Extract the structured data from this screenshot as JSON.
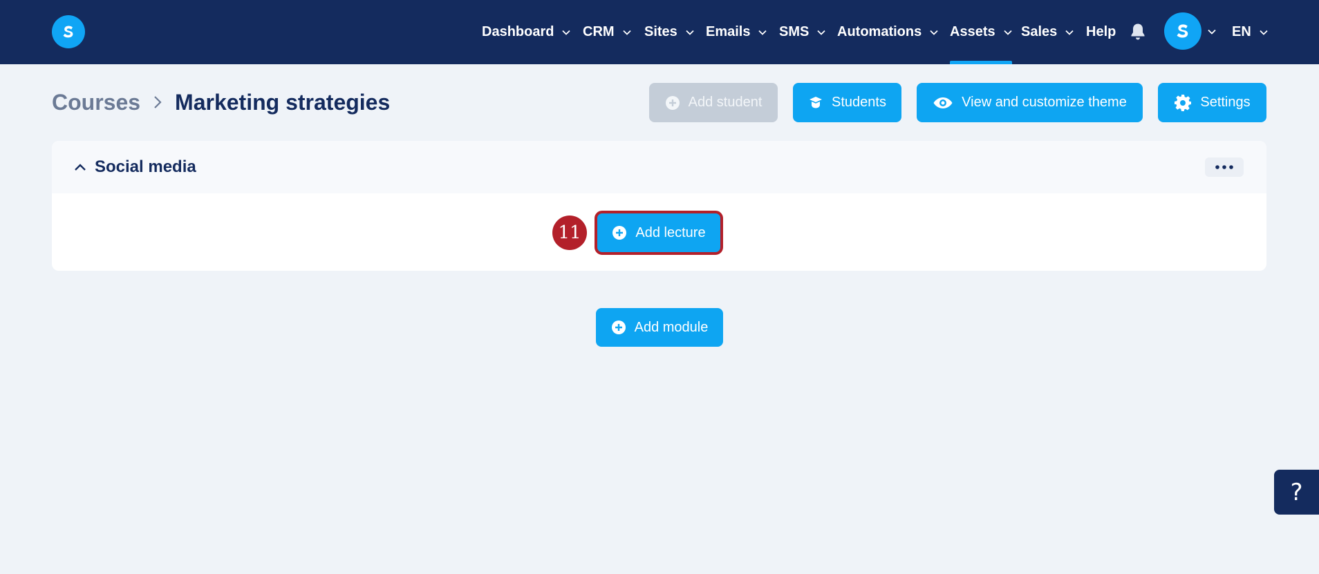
{
  "nav": {
    "items": [
      {
        "label": "Dashboard",
        "has_dropdown": true
      },
      {
        "label": "CRM",
        "has_dropdown": true
      },
      {
        "label": "Sites",
        "has_dropdown": true
      },
      {
        "label": "Emails",
        "has_dropdown": true
      },
      {
        "label": "SMS",
        "has_dropdown": true
      },
      {
        "label": "Automations",
        "has_dropdown": true
      },
      {
        "label": "Assets",
        "has_dropdown": true,
        "active": true
      },
      {
        "label": "Sales",
        "has_dropdown": true
      },
      {
        "label": "Help",
        "has_dropdown": false
      }
    ],
    "language": "EN",
    "icons": {
      "logo": "systeme-logo-icon",
      "bell": "bell-icon",
      "avatar": "user-avatar-icon"
    }
  },
  "header": {
    "breadcrumb_parent": "Courses",
    "breadcrumb_current": "Marketing strategies",
    "buttons": {
      "add_student": "Add student",
      "students": "Students",
      "view_theme": "View and customize theme",
      "settings": "Settings"
    }
  },
  "module": {
    "title": "Social media",
    "add_lecture_label": "Add lecture",
    "step_number": "11"
  },
  "add_module_label": "Add module",
  "help_label": "?",
  "colors": {
    "nav_bg": "#142b5e",
    "accent": "#0ea5f2",
    "page_bg": "#eff3f8",
    "highlight": "#b3202a",
    "disabled": "#c4cdd8"
  }
}
